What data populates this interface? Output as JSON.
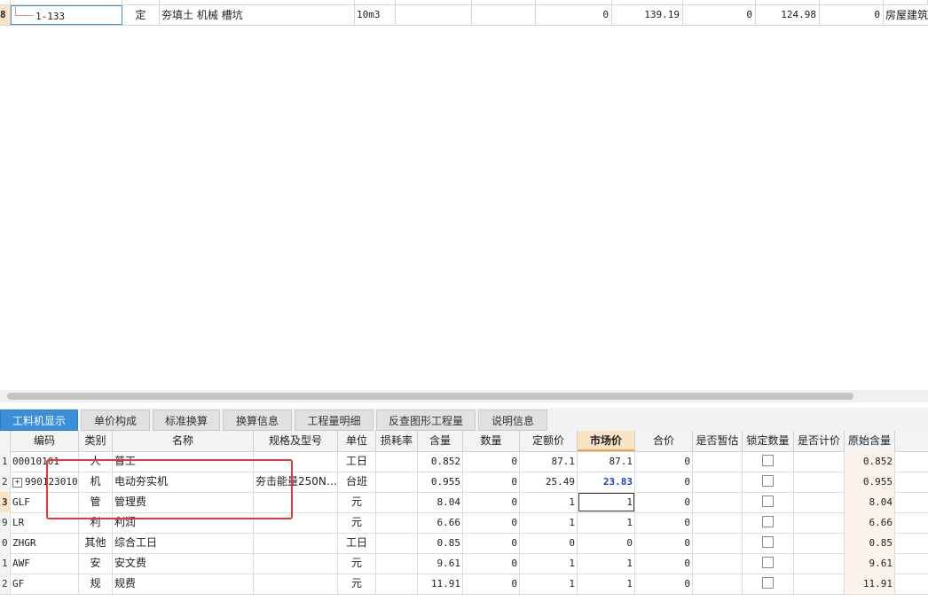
{
  "top_grid": {
    "row": {
      "row_num": "8",
      "code": "1-133",
      "type": "定",
      "name": "夯填土 机械 槽坑",
      "unit": "10m3",
      "v1": "0",
      "v2": "139.19",
      "v3": "0",
      "v4": "124.98",
      "v5": "0",
      "category": "房屋建筑"
    }
  },
  "tabs": [
    "工料机显示",
    "单价构成",
    "标准换算",
    "换算信息",
    "工程量明细",
    "反查图形工程量",
    "说明信息"
  ],
  "columns": [
    "编码",
    "类别",
    "名称",
    "规格及型号",
    "单位",
    "损耗率",
    "含量",
    "数量",
    "定额价",
    "市场价",
    "合价",
    "是否暂估",
    "锁定数量",
    "是否计价",
    "原始含量"
  ],
  "rows": [
    {
      "rn": "1",
      "code": "00010101",
      "type": "人",
      "name": "普工",
      "spec": "",
      "unit": "工日",
      "loss": "",
      "content": "0.852",
      "qty": "0",
      "quota": "87.1",
      "market": "87.1",
      "total": "0",
      "orig": "0.852"
    },
    {
      "rn": "2",
      "code": "990123010",
      "type": "机",
      "name": "电动夯实机",
      "spec": "夯击能量250N…",
      "unit": "台班",
      "loss": "",
      "content": "0.955",
      "qty": "0",
      "quota": "25.49",
      "market": "23.83",
      "total": "0",
      "orig": "0.955"
    },
    {
      "rn": "3",
      "code": "GLF",
      "type": "管",
      "name": "管理费",
      "spec": "",
      "unit": "元",
      "loss": "",
      "content": "8.04",
      "qty": "0",
      "quota": "1",
      "market": "1",
      "total": "0",
      "orig": "8.04"
    },
    {
      "rn": "9",
      "code": "LR",
      "type": "利",
      "name": "利润",
      "spec": "",
      "unit": "元",
      "loss": "",
      "content": "6.66",
      "qty": "0",
      "quota": "1",
      "market": "1",
      "total": "0",
      "orig": "6.66"
    },
    {
      "rn": "0",
      "code": "ZHGR",
      "type": "其他",
      "name": "综合工日",
      "spec": "",
      "unit": "工日",
      "loss": "",
      "content": "0.85",
      "qty": "0",
      "quota": "0",
      "market": "0",
      "total": "0",
      "orig": "0.85"
    },
    {
      "rn": "1",
      "code": "AWF",
      "type": "安",
      "name": "安文费",
      "spec": "",
      "unit": "元",
      "loss": "",
      "content": "9.61",
      "qty": "0",
      "quota": "1",
      "market": "1",
      "total": "0",
      "orig": "9.61"
    },
    {
      "rn": "2",
      "code": "GF",
      "type": "规",
      "name": "规费",
      "spec": "",
      "unit": "元",
      "loss": "",
      "content": "11.91",
      "qty": "0",
      "quota": "1",
      "market": "1",
      "total": "0",
      "orig": "11.91"
    }
  ]
}
